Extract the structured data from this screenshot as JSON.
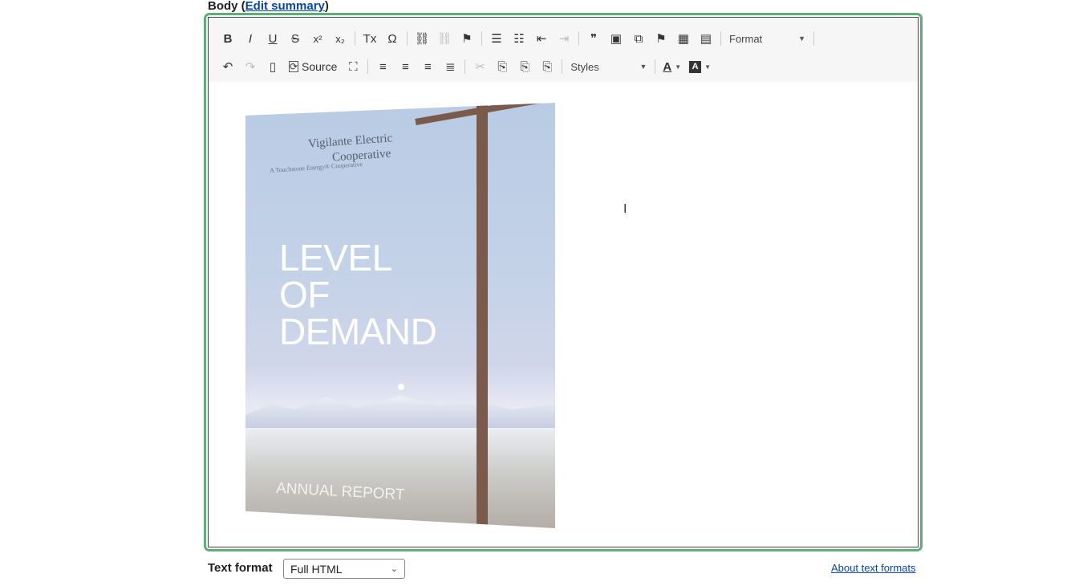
{
  "field": {
    "label_prefix": "Body (",
    "edit_summary_link": "Edit summary",
    "label_suffix": ")"
  },
  "toolbar": {
    "row1": [
      {
        "name": "bold-button",
        "icon": "bold-icon",
        "glyph": "B"
      },
      {
        "name": "italic-button",
        "icon": "italic-icon",
        "glyph": "I"
      },
      {
        "name": "underline-button",
        "icon": "underline-icon",
        "glyph": "U"
      },
      {
        "name": "strikethrough-button",
        "icon": "strikethrough-icon",
        "glyph": "S"
      },
      {
        "name": "superscript-button",
        "icon": "superscript-icon",
        "glyph": "x²"
      },
      {
        "name": "subscript-button",
        "icon": "subscript-icon",
        "glyph": "x₂"
      },
      {
        "sep": true
      },
      {
        "name": "remove-format-button",
        "icon": "remove-format-icon",
        "glyph": "Tx"
      },
      {
        "name": "special-char-button",
        "icon": "omega-icon",
        "glyph": "Ω"
      },
      {
        "sep": true
      },
      {
        "name": "link-button",
        "icon": "link-icon",
        "glyph": "⛓"
      },
      {
        "name": "unlink-button",
        "icon": "unlink-icon",
        "glyph": "⛓",
        "disabled": true
      },
      {
        "name": "anchor-button",
        "icon": "flag-icon",
        "glyph": "⚑"
      },
      {
        "sep": true
      },
      {
        "name": "bulleted-list-button",
        "icon": "bulleted-list-icon",
        "glyph": "☰"
      },
      {
        "name": "numbered-list-button",
        "icon": "numbered-list-icon",
        "glyph": "☷"
      },
      {
        "name": "outdent-button",
        "icon": "outdent-icon",
        "glyph": "⇤"
      },
      {
        "name": "indent-button",
        "icon": "indent-icon",
        "glyph": "⇥",
        "disabled": true
      },
      {
        "sep": true
      },
      {
        "name": "blockquote-button",
        "icon": "quote-icon",
        "glyph": "❞"
      },
      {
        "name": "image-button",
        "icon": "image-icon",
        "glyph": "▣"
      },
      {
        "name": "media-button",
        "icon": "media-library-icon",
        "glyph": "⧉"
      },
      {
        "name": "flag-button",
        "icon": "flag-icon",
        "glyph": "⚑"
      },
      {
        "name": "table-button",
        "icon": "table-icon",
        "glyph": "▦"
      },
      {
        "name": "horizontal-rule-button",
        "icon": "horizontal-rule-icon",
        "glyph": "▤"
      },
      {
        "sep": true
      }
    ],
    "format_label": "Format",
    "row2": [
      {
        "name": "undo-button",
        "icon": "undo-icon",
        "glyph": "↶"
      },
      {
        "name": "redo-button",
        "icon": "redo-icon",
        "glyph": "↷",
        "disabled": true
      },
      {
        "name": "templates-button",
        "icon": "templates-icon",
        "glyph": "▯"
      }
    ],
    "source_label": "Source",
    "row2b": [
      {
        "name": "maximize-button",
        "icon": "maximize-icon",
        "glyph": "⛶"
      },
      {
        "sep": true
      },
      {
        "name": "align-left-button",
        "icon": "align-left-icon",
        "glyph": "≡"
      },
      {
        "name": "align-center-button",
        "icon": "align-center-icon",
        "glyph": "≡"
      },
      {
        "name": "align-right-button",
        "icon": "align-right-icon",
        "glyph": "≡"
      },
      {
        "name": "justify-button",
        "icon": "justify-icon",
        "glyph": "≣"
      },
      {
        "sep": true
      },
      {
        "name": "cut-button",
        "icon": "scissors-icon",
        "glyph": "✂",
        "disabled": true
      },
      {
        "name": "copy-button",
        "icon": "copy-icon",
        "glyph": "⎘"
      },
      {
        "name": "paste-button",
        "icon": "paste-icon",
        "glyph": "⎘"
      },
      {
        "name": "paste-text-button",
        "icon": "paste-text-icon",
        "glyph": "⎘"
      },
      {
        "sep": true
      }
    ],
    "styles_label": "Styles",
    "text_color_glyph": "A",
    "bg_color_glyph": "A"
  },
  "cover": {
    "logo_line1": "Vigilante Electric",
    "logo_line2": "Cooperative",
    "logo_tag": "A Touchstone Energy® Cooperative",
    "title_line1": "LEVEL",
    "title_line2": "OF",
    "title_line3": "DEMAND",
    "subtitle": "ANNUAL REPORT"
  },
  "text_format": {
    "label": "Text format",
    "selected": "Full HTML",
    "about_link": "About text formats"
  },
  "colors": {
    "focus_border": "#5fae75",
    "link": "#0645ad"
  }
}
